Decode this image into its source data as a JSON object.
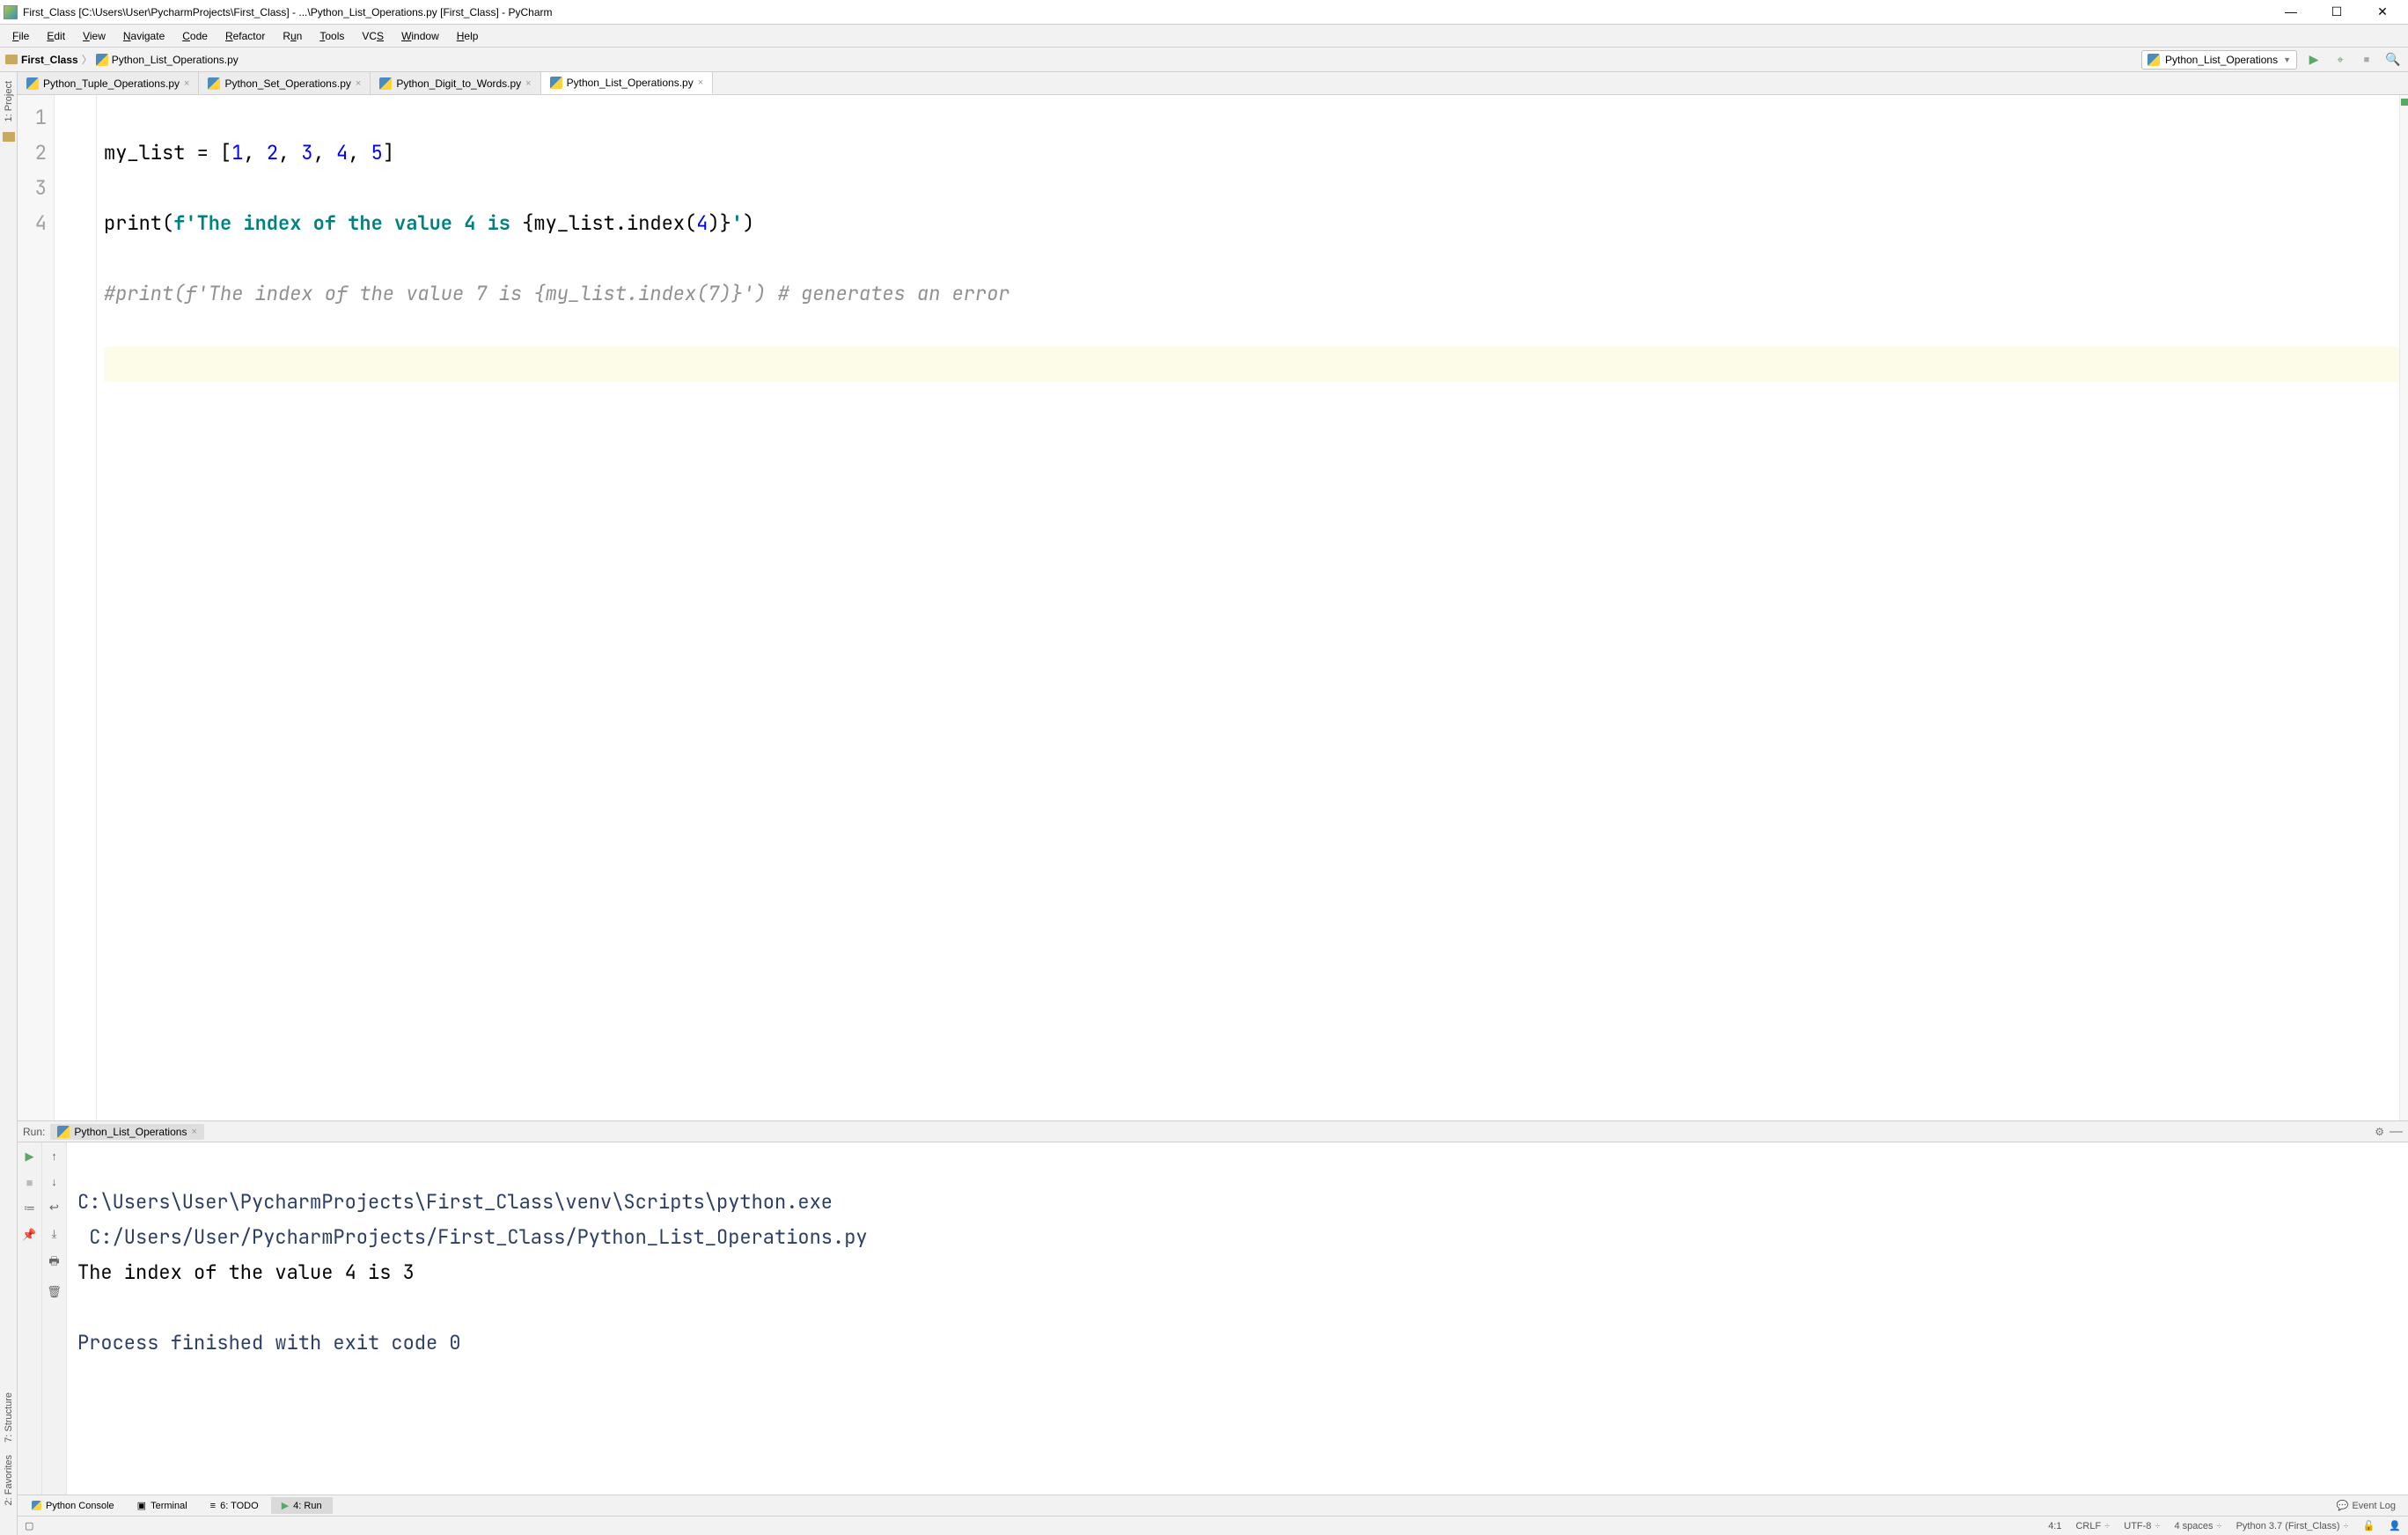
{
  "titlebar": {
    "text": "First_Class [C:\\Users\\User\\PycharmProjects\\First_Class] - ...\\Python_List_Operations.py [First_Class] - PyCharm"
  },
  "menu": [
    "File",
    "Edit",
    "View",
    "Navigate",
    "Code",
    "Refactor",
    "Run",
    "Tools",
    "VCS",
    "Window",
    "Help"
  ],
  "breadcrumb": {
    "root": "First_Class",
    "file": "Python_List_Operations.py"
  },
  "run_config_selected": "Python_List_Operations",
  "editor_tabs": [
    {
      "label": "Python_Tuple_Operations.py",
      "active": false
    },
    {
      "label": "Python_Set_Operations.py",
      "active": false
    },
    {
      "label": "Python_Digit_to_Words.py",
      "active": false
    },
    {
      "label": "Python_List_Operations.py",
      "active": true
    }
  ],
  "code": {
    "lines": [
      "1",
      "2",
      "3",
      "4"
    ]
  },
  "run": {
    "label": "Run:",
    "tab": "Python_List_Operations",
    "out_interp": "C:\\Users\\User\\PycharmProjects\\First_Class\\venv\\Scripts\\python.exe",
    "out_script": " C:/Users/User/PycharmProjects/First_Class/Python_List_Operations.py",
    "out_line": "The index of the value 4 is 3",
    "out_exit": "Process finished with exit code 0"
  },
  "left_tabs": {
    "project": "1: Project",
    "structure": "7: Structure",
    "favorites": "2: Favorites"
  },
  "bottom_tabs": {
    "python_console": "Python Console",
    "terminal": "Terminal",
    "todo": "6: TODO",
    "run": "4: Run",
    "event_log": "Event Log"
  },
  "status": {
    "pos": "4:1",
    "eol": "CRLF",
    "enc": "UTF-8",
    "indent": "4 spaces",
    "interp": "Python 3.7 (First_Class)"
  }
}
